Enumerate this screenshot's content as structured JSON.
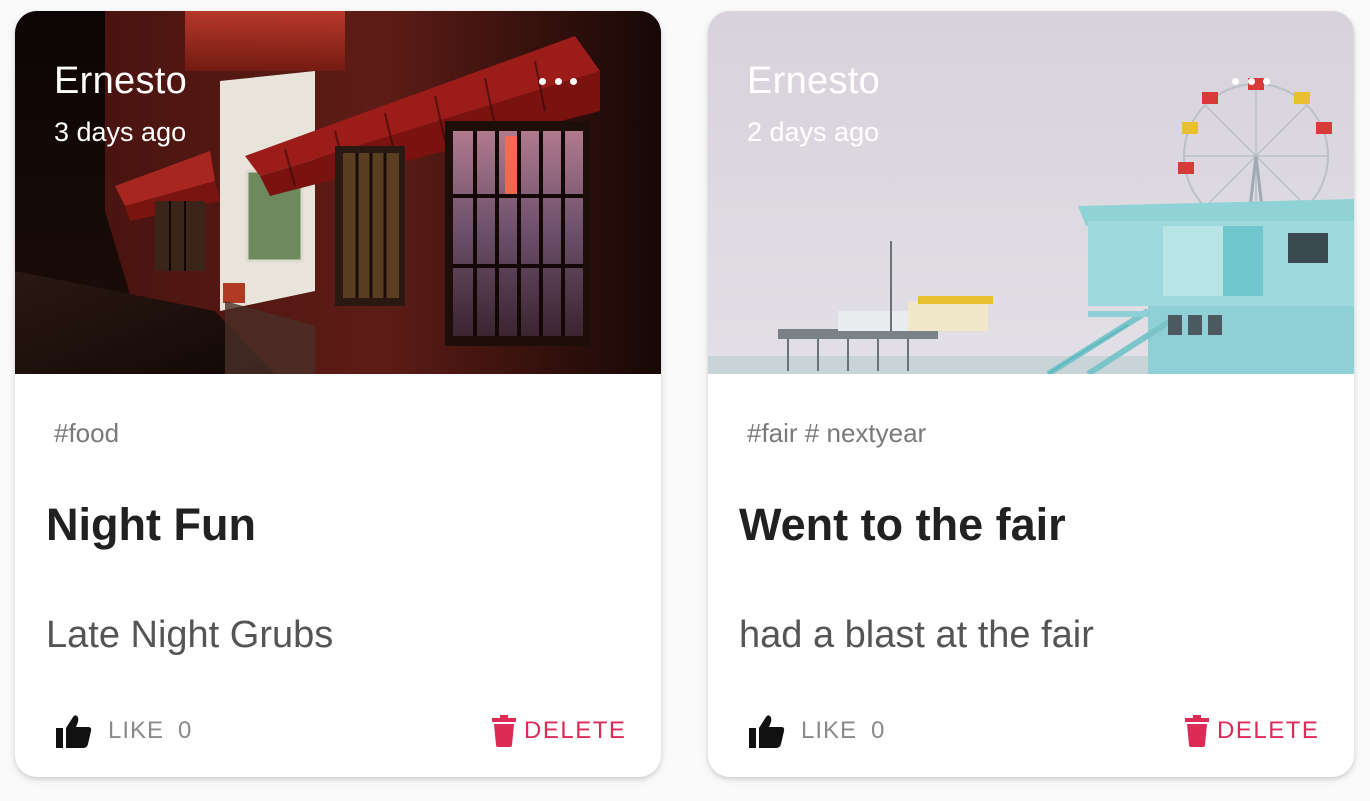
{
  "colors": {
    "delete": "#dc2b57",
    "icon_dark": "#111111",
    "text_muted": "#7a7a7a"
  },
  "posts": [
    {
      "author": "Ernesto",
      "time": "3 days ago",
      "tags": "#food",
      "title": "Night Fun",
      "message": "Late Night Grubs",
      "like_label": "LIKE",
      "like_count": "0",
      "delete_label": "DELETE",
      "image": "restaurant-storefront-at-night-photo"
    },
    {
      "author": "Ernesto",
      "time": "2 days ago",
      "tags": "#fair # nextyear",
      "title": "Went to the fair",
      "message": "had a blast at the fair",
      "like_label": "LIKE",
      "like_count": "0",
      "delete_label": "DELETE",
      "image": "lifeguard-tower-and-pier-photo"
    }
  ]
}
